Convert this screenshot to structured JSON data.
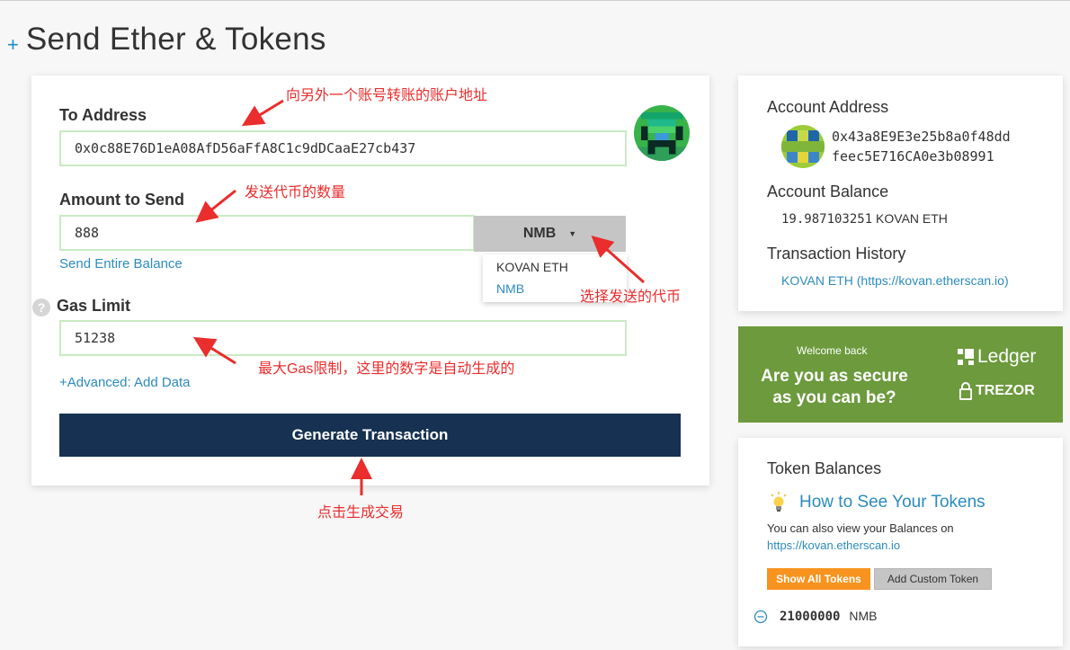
{
  "page": {
    "title": "Send Ether & Tokens",
    "plus": "+"
  },
  "form": {
    "to_label": "To Address",
    "to_value": "0x0c88E76D1eA08AfD56aFfA8C1c9dDCaaE27cb437",
    "amount_label": "Amount to Send",
    "amount_value": "888",
    "token_selected": "NMB",
    "token_options": [
      "KOVAN ETH",
      "NMB"
    ],
    "send_entire": "Send Entire Balance",
    "gas_label": "Gas Limit",
    "gas_value": "51238",
    "help_glyph": "?",
    "advanced": "+Advanced: Add Data",
    "generate": "Generate Transaction"
  },
  "annotations": {
    "to_address": "向另外一个账号转账的账户地址",
    "amount": "发送代币的数量",
    "token": "选择发送的代币",
    "gas": "最大Gas限制，这里的数字是自动生成的",
    "generate": "点击生成交易"
  },
  "account": {
    "address_label": "Account Address",
    "address_line1": "0x43a8E9E3e25b8a0f48dd",
    "address_line2": "feec5E716CA0e3b08991",
    "balance_label": "Account Balance",
    "balance_value": "19.987103251",
    "balance_unit": "KOVAN ETH",
    "history_label": "Transaction History",
    "history_link": "KOVAN ETH (https://kovan.etherscan.io)"
  },
  "banner": {
    "welcome": "Welcome back",
    "question_line1": "Are you as secure",
    "question_line2": "as you can be?",
    "ledger": "Ledger",
    "trezor": "TREZOR"
  },
  "tokens": {
    "title": "Token Balances",
    "how_to": "How to See Your Tokens",
    "note_line1": "You can also view your Balances on",
    "note_link": "https://kovan.etherscan.io",
    "show_all": "Show All Tokens",
    "add_custom": "Add Custom Token",
    "item_amount": "21000000",
    "item_symbol": "NMB"
  },
  "colors": {
    "primary_button": "#163151",
    "link": "#2c8bbd",
    "input_border": "#c9eac2",
    "banner": "#6c9a3d",
    "annotation": "#ea2d2d",
    "show_all_bg": "#f7931e",
    "add_custom_bg": "#c5c5c5"
  },
  "icons": [
    "plus-icon",
    "identicon",
    "caret-down-icon",
    "help-icon",
    "ledger-icon",
    "trezor-lock-icon",
    "lightbulb-icon",
    "minus-circle-icon"
  ]
}
